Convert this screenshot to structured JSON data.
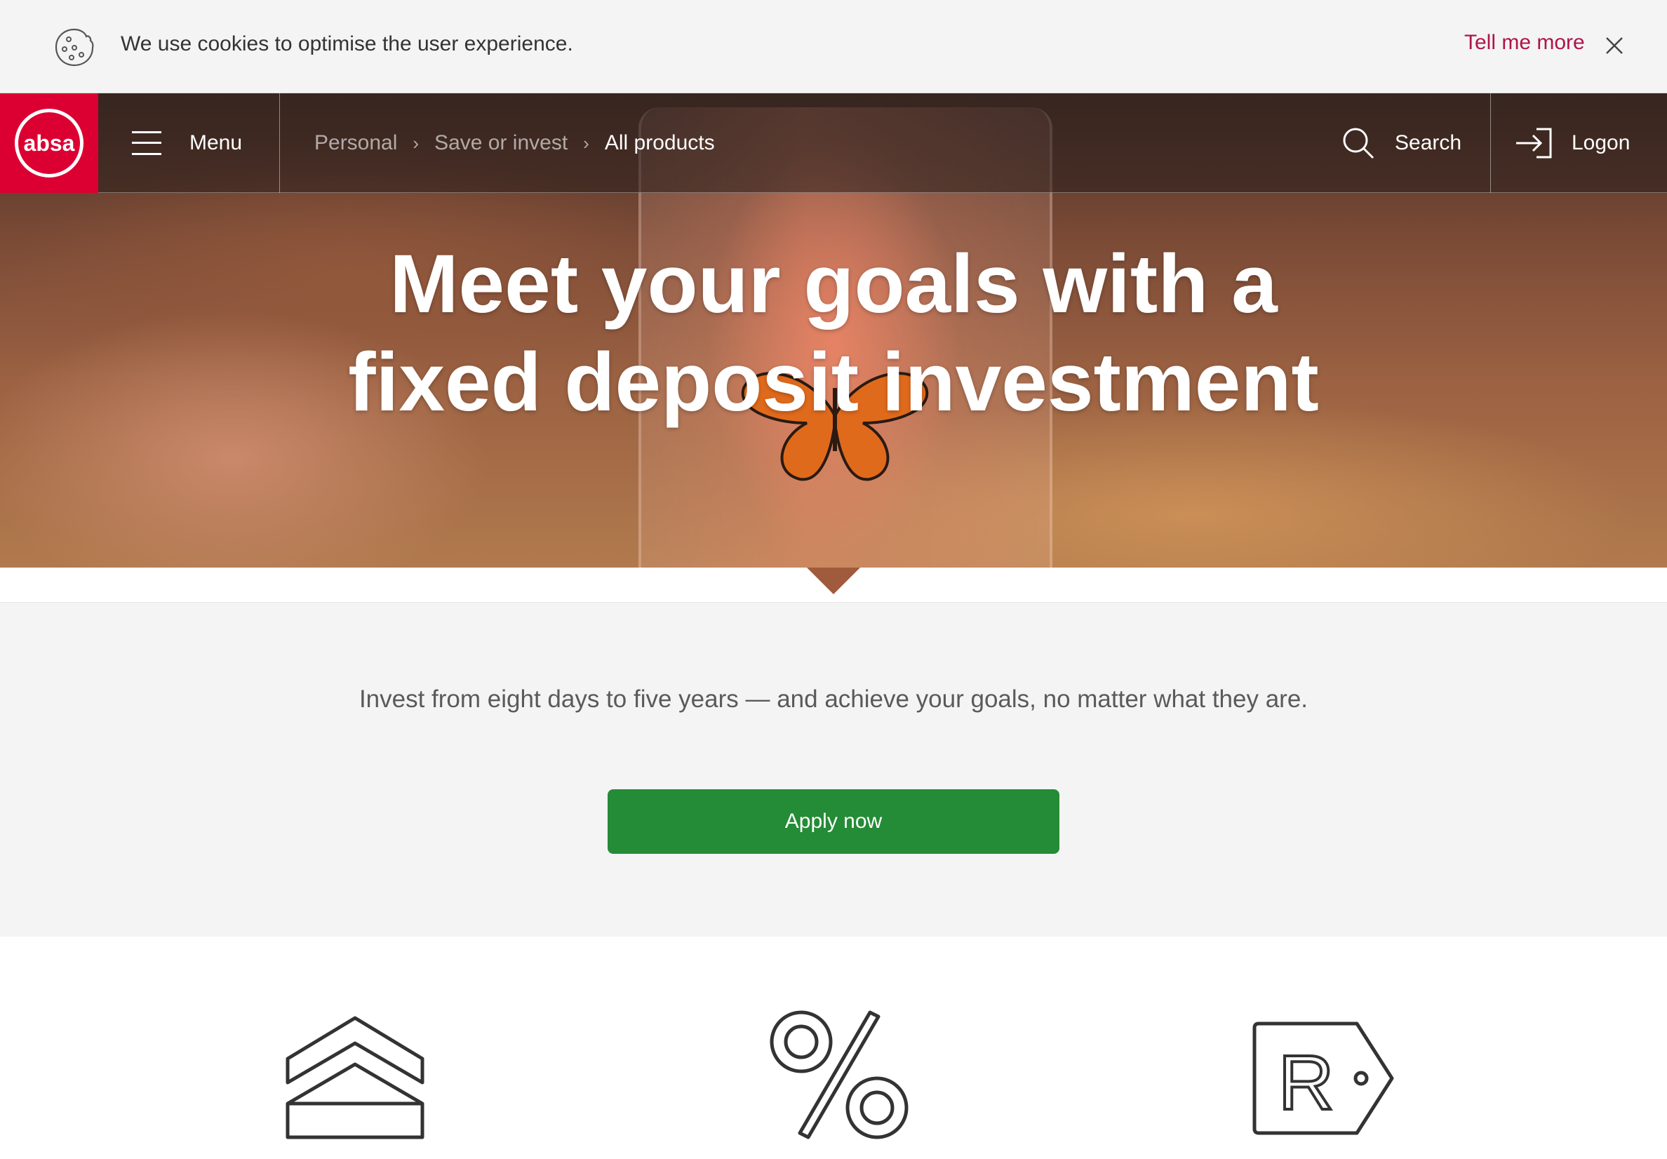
{
  "cookie_bar": {
    "message": "We use cookies to optimise the user experience.",
    "more_link": "Tell me more",
    "icon": "cookie-icon",
    "close_icon": "close-icon"
  },
  "nav": {
    "logo_text": "absa",
    "menu_label": "Menu",
    "breadcrumbs": [
      "Personal",
      "Save or invest",
      "All products"
    ],
    "search_label": "Search",
    "logon_label": "Logon"
  },
  "hero": {
    "title": "Meet your goals with a fixed deposit investment"
  },
  "intro": {
    "text": "Invest from eight days to five years — and achieve your goals, no matter what they are.",
    "cta_label": "Apply now"
  },
  "features": {
    "icons": [
      "double-up-arrow-icon",
      "percent-icon",
      "rand-price-tag-icon"
    ]
  },
  "colors": {
    "brand_red": "#dc0032",
    "link_red": "#af144b",
    "cta_green": "#248b36",
    "section_bg": "#f4f4f4"
  }
}
